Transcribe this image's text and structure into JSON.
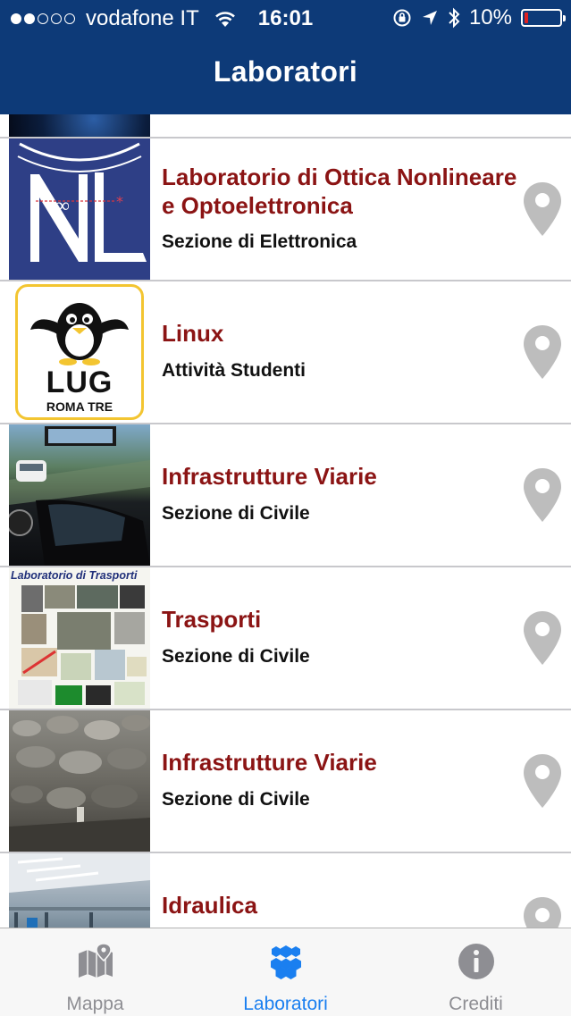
{
  "status_bar": {
    "carrier": "vodafone IT",
    "time": "16:01",
    "battery": "10%",
    "signal_dots_on": 2,
    "signal_dots_total": 5
  },
  "nav": {
    "title": "Laboratori"
  },
  "labs": [
    {
      "title": "Laboratorio di Ottica Nonlineare e Optoelettronica",
      "subtitle": "Sezione di Elettronica",
      "thumb": "nel-logo"
    },
    {
      "title": "Linux",
      "subtitle": "Attività Studenti",
      "thumb": "lug-logo",
      "logo_text_1": "LUG",
      "logo_text_2": "ROMA TRE"
    },
    {
      "title": "Infrastrutture Viarie",
      "subtitle": "Sezione di Civile",
      "thumb": "driving-simulator-photo"
    },
    {
      "title": "Trasporti",
      "subtitle": "Sezione di Civile",
      "thumb": "trasporti-collage",
      "thumb_caption": "Laboratorio di Trasporti"
    },
    {
      "title": "Infrastrutture Viarie",
      "subtitle": "Sezione di Civile",
      "thumb": "ballast-stones-photo"
    },
    {
      "title": "Idraulica",
      "subtitle": "",
      "thumb": "hydraulics-lab-photo"
    }
  ],
  "tabs": [
    {
      "label": "Mappa",
      "icon": "map-icon",
      "active": false
    },
    {
      "label": "Laboratori",
      "icon": "hexagons-icon",
      "active": true
    },
    {
      "label": "Crediti",
      "icon": "info-icon",
      "active": false
    }
  ],
  "colors": {
    "nav_bar": "#0d3a78",
    "lab_title": "#8b1414",
    "active_tab": "#1a7ff0",
    "inactive_tab": "#8e8e93",
    "pin": "#bdbdbd",
    "battery_low": "#e02020"
  }
}
